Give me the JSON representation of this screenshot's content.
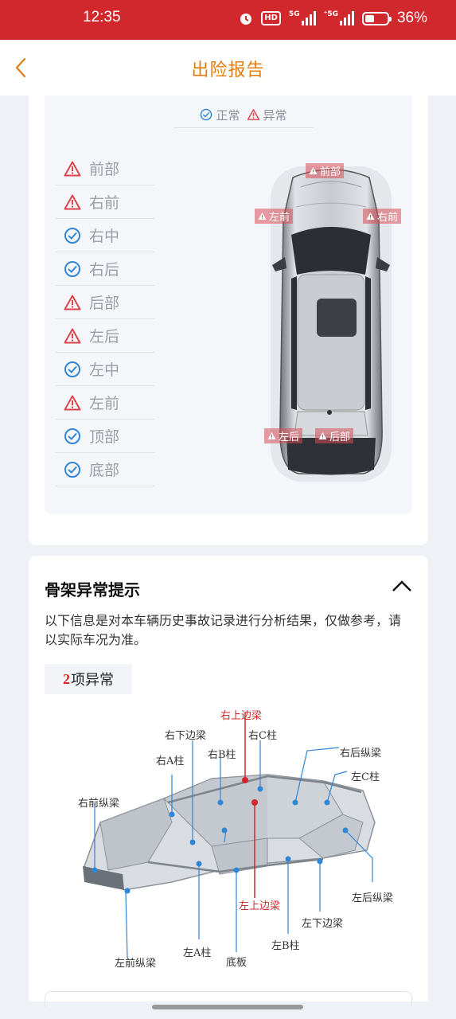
{
  "status_bar": {
    "time": "12:35",
    "hd_label": "HD",
    "sig1_label": "5G",
    "sig2_label": "⁺5G",
    "battery_pct": "36%",
    "battery_level": 0.36
  },
  "nav": {
    "title": "出险报告"
  },
  "legend": {
    "normal": "正常",
    "abnormal": "异常"
  },
  "parts": [
    {
      "label": "前部",
      "status": "abnormal"
    },
    {
      "label": "右前",
      "status": "abnormal"
    },
    {
      "label": "右中",
      "status": "normal"
    },
    {
      "label": "右后",
      "status": "normal"
    },
    {
      "label": "后部",
      "status": "abnormal"
    },
    {
      "label": "左后",
      "status": "abnormal"
    },
    {
      "label": "左中",
      "status": "normal"
    },
    {
      "label": "左前",
      "status": "abnormal"
    },
    {
      "label": "顶部",
      "status": "normal"
    },
    {
      "label": "底部",
      "status": "normal"
    }
  ],
  "car_tags": {
    "front": "前部",
    "left_front": "左前",
    "right_front": "右前",
    "left_rear": "左后",
    "rear": "后部"
  },
  "frame_section": {
    "title": "骨架异常提示",
    "description": "以下信息是对本车辆历史事故记录进行分析结果，仅做参考，请以实际车况为准。",
    "count": "2",
    "count_suffix": "项异常",
    "labels": {
      "right_upper_rail": "右上边梁",
      "right_lower_rail": "右下边梁",
      "right_c_pillar": "右C柱",
      "right_a_pillar": "右A柱",
      "right_b_pillar": "右B柱",
      "right_rear_longitudinal": "右后纵梁",
      "left_c_pillar": "左C柱",
      "right_front_longitudinal": "右前纵梁",
      "left_upper_rail": "左上边梁",
      "left_rear_longitudinal": "左后纵梁",
      "left_lower_rail": "左下边梁",
      "left_b_pillar": "左B柱",
      "left_a_pillar": "左A柱",
      "floor": "底板",
      "left_front_longitudinal": "左前纵梁"
    }
  },
  "colors": {
    "status_bar": "#d0282c",
    "nav_title": "#e07c12",
    "normal": "#2f86d6",
    "abnormal": "#d9444a"
  }
}
